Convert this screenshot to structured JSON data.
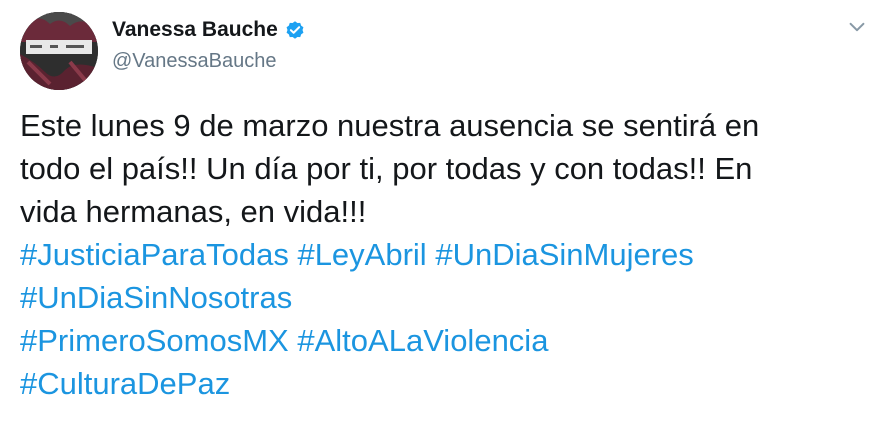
{
  "user": {
    "display_name": "Vanessa Bauche",
    "handle": "@VanessaBauche",
    "verified": true,
    "avatar_icon": "profile-photo"
  },
  "tweet": {
    "text_lines": [
      "Este lunes 9 de marzo nuestra ausencia se sentirá en",
      "todo el país!! Un día por ti, por todas y con todas!! En",
      "vida hermanas, en vida!!!"
    ],
    "hashtag_lines": [
      [
        "#JusticiaParaTodas",
        "#LeyAbril",
        "#UnDiaSinMujeres"
      ],
      [
        "#UnDiaSinNosotras"
      ],
      [
        "#PrimeroSomosMX",
        "#AltoALaViolencia"
      ],
      [
        "#CulturaDePaz"
      ]
    ]
  },
  "colors": {
    "hashtag": "#1b95e0",
    "verified_badge": "#1da1f2",
    "handle": "#657786",
    "text": "#14171a"
  },
  "icons": {
    "verified": "verified-badge-icon",
    "menu": "chevron-down-icon"
  }
}
